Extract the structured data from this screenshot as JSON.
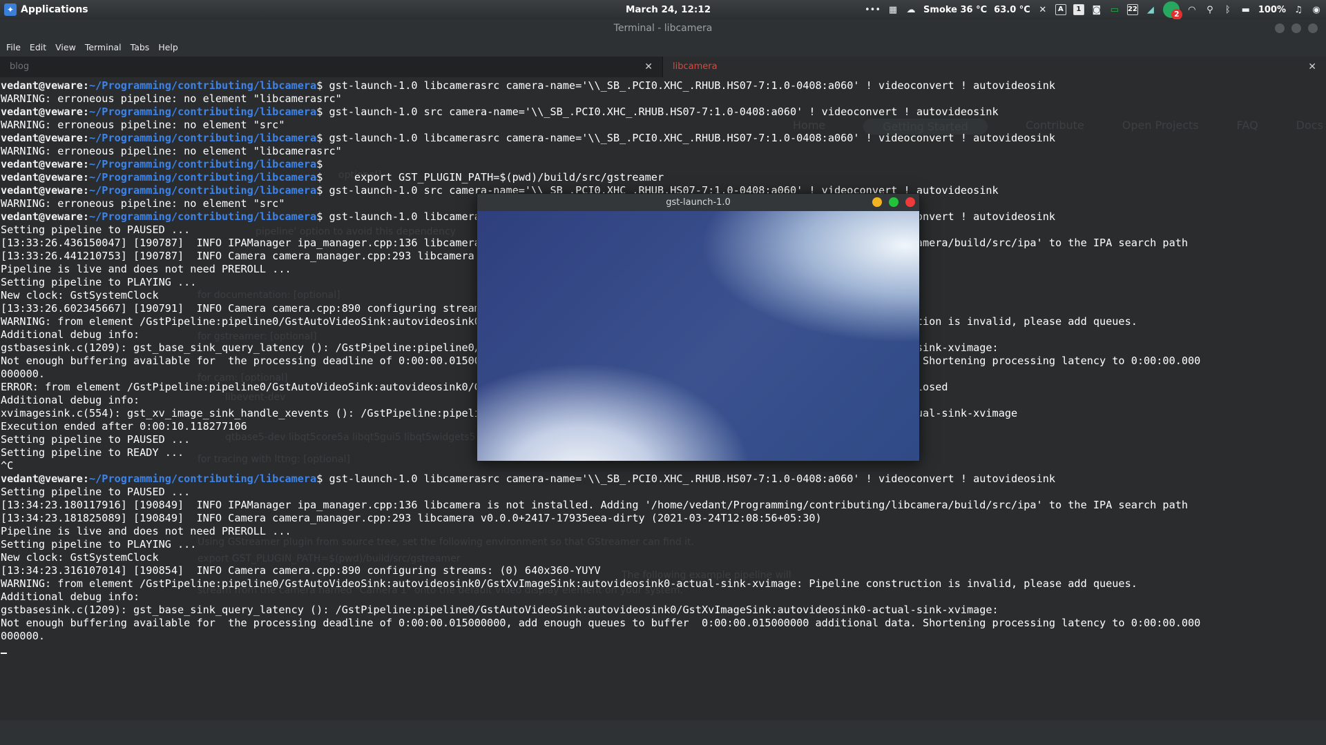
{
  "panel": {
    "apps_label": "Applications",
    "clock": "March 24, 12:12",
    "weather": "Smoke 36 °C",
    "temperature": "63.0 °C",
    "battery": "100%",
    "notify_count": "2",
    "workspace": "1",
    "keyboard": "A",
    "chat_num": "22"
  },
  "window": {
    "title": "Terminal - libcamera"
  },
  "menu": [
    "File",
    "Edit",
    "View",
    "Terminal",
    "Tabs",
    "Help"
  ],
  "tabs": [
    {
      "label": "blog"
    },
    {
      "label": "libcamera"
    }
  ],
  "prompt": {
    "user": "vedant@veware",
    "path": "~/Programming/contributing/libcamera"
  },
  "lines": [
    {
      "p": true,
      "t": "gst-launch-1.0 libcamerasrc camera-name='\\\\_SB_.PCI0.XHC_.RHUB.HS07-7:1.0-0408:a060' ! videoconvert ! autovideosink"
    },
    {
      "t": "WARNING: erroneous pipeline: no element \"libcamerasrc\""
    },
    {
      "p": true,
      "t": "gst-launch-1.0 src camera-name='\\\\_SB_.PCI0.XHC_.RHUB.HS07-7:1.0-0408:a060' ! videoconvert ! autovideosink"
    },
    {
      "t": "WARNING: erroneous pipeline: no element \"src\""
    },
    {
      "p": true,
      "t": "gst-launch-1.0 libcamerasrc camera-name='\\\\_SB_.PCI0.XHC_.RHUB.HS07-7:1.0-0408:a060' ! videoconvert ! autovideosink"
    },
    {
      "t": "WARNING: erroneous pipeline: no element \"libcamerasrc\""
    },
    {
      "p": true,
      "t": ""
    },
    {
      "p": true,
      "t": "    export GST_PLUGIN_PATH=$(pwd)/build/src/gstreamer"
    },
    {
      "p": true,
      "t": "gst-launch-1.0 src camera-name='\\\\_SB_.PCI0.XHC_.RHUB.HS07-7:1.0-0408:a060' ! videoconvert ! autovideosink"
    },
    {
      "t": "WARNING: erroneous pipeline: no element \"src\""
    },
    {
      "p": true,
      "t": "gst-launch-1.0 libcamerasrc camera-name='\\\\_SB_.PCI0.XHC_.RHUB.HS07-7:1.0-0408:a060' ! videoconvert ! autovideosink"
    },
    {
      "t": "Setting pipeline to PAUSED ..."
    },
    {
      "t": "[13:33:26.436150047] [190787]  INFO IPAManager ipa_manager.cpp:136 libcamera is not installed. Adding '/home/vedant/Programming/contributing/libcamera/build/src/ipa' to the IPA search path"
    },
    {
      "t": "[13:33:26.441210753] [190787]  INFO Camera camera_manager.cpp:293 libcamera v0.0.0+2417-17935eea-dirty (2021-03-24T12:08:56+05:30)"
    },
    {
      "t": "Pipeline is live and does not need PREROLL ..."
    },
    {
      "t": "Setting pipeline to PLAYING ..."
    },
    {
      "t": "New clock: GstSystemClock"
    },
    {
      "t": "[13:33:26.602345667] [190791]  INFO Camera camera.cpp:890 configuring streams: (0) 640x360-YUYV"
    },
    {
      "t": "WARNING: from element /GstPipeline:pipeline0/GstAutoVideoSink:autovideosink0/GstXvImageSink:autovideosink0-actual-sink-xvimage: Pipeline construction is invalid, please add queues."
    },
    {
      "t": "Additional debug info:"
    },
    {
      "t": "gstbasesink.c(1209): gst_base_sink_query_latency (): /GstPipeline:pipeline0/GstAutoVideoSink:autovideosink0/GstXvImageSink:autovideosink0-actual-sink-xvimage:"
    },
    {
      "t": "Not enough buffering available for  the processing deadline of 0:00:00.015000000, add enough queues to buffer  0:00:00.015000000 additional data. Shortening processing latency to 0:00:00.000"
    },
    {
      "t": "000000."
    },
    {
      "t": "ERROR: from element /GstPipeline:pipeline0/GstAutoVideoSink:autovideosink0/GstXvImageSink:autovideosink0-actual-sink-xvimage: Output window was closed"
    },
    {
      "t": "Additional debug info:"
    },
    {
      "t": "xvimagesink.c(554): gst_xv_image_sink_handle_xevents (): /GstPipeline:pipeline0/GstAutoVideoSink:autovideosink0/GstXvImageSink:autovideosink0-actual-sink-xvimage"
    },
    {
      "t": "Execution ended after 0:00:10.118277106"
    },
    {
      "t": "Setting pipeline to PAUSED ..."
    },
    {
      "t": "Setting pipeline to READY ..."
    },
    {
      "t": "^C"
    },
    {
      "p": true,
      "t": "gst-launch-1.0 libcamerasrc camera-name='\\\\_SB_.PCI0.XHC_.RHUB.HS07-7:1.0-0408:a060' ! videoconvert ! autovideosink"
    },
    {
      "t": "Setting pipeline to PAUSED ..."
    },
    {
      "t": "[13:34:23.180117916] [190849]  INFO IPAManager ipa_manager.cpp:136 libcamera is not installed. Adding '/home/vedant/Programming/contributing/libcamera/build/src/ipa' to the IPA search path"
    },
    {
      "t": "[13:34:23.181825089] [190849]  INFO Camera camera_manager.cpp:293 libcamera v0.0.0+2417-17935eea-dirty (2021-03-24T12:08:56+05:30)"
    },
    {
      "t": "Pipeline is live and does not need PREROLL ..."
    },
    {
      "t": "Setting pipeline to PLAYING ..."
    },
    {
      "t": "New clock: GstSystemClock"
    },
    {
      "t": "[13:34:23.316107014] [190854]  INFO Camera camera.cpp:890 configuring streams: (0) 640x360-YUYV"
    },
    {
      "t": "WARNING: from element /GstPipeline:pipeline0/GstAutoVideoSink:autovideosink0/GstXvImageSink:autovideosink0-actual-sink-xvimage: Pipeline construction is invalid, please add queues."
    },
    {
      "t": "Additional debug info:"
    },
    {
      "t": "gstbasesink.c(1209): gst_base_sink_query_latency (): /GstPipeline:pipeline0/GstAutoVideoSink:autovideosink0/GstXvImageSink:autovideosink0-actual-sink-xvimage:"
    },
    {
      "t": "Not enough buffering available for  the processing deadline of 0:00:00.015000000, add enough queues to buffer  0:00:00.015000000 additional data. Shortening processing latency to 0:00:00.000"
    },
    {
      "t": "000000."
    }
  ],
  "ghost": {
    "nav": [
      "Home",
      "Getting Started",
      "Contribute",
      "Open Projects",
      "FAQ",
      "Docs"
    ],
    "texts": [
      "optional]",
      "pipeline' option to avoid this dependency",
      "for documentation: [optional]",
      "for gstreamer: [optional]",
      "for cam: [optional]",
      "libevent-dev",
      "qtbase5-dev libqt5core5a libqt5gui5 libqt5widgets5",
      "for tracing with lttng: [optional]",
      "Using GStreamer plugin from source tree, set the following environment so that GStreamer can find it.",
      "export GST_PLUGIN_PATH=$(pwd)/build/src/gstreamer",
      "The following example pipeline will",
      "stream from the camera named \"Camera 1\" onto the default video display element on your system."
    ]
  },
  "video_window": {
    "title": "gst-launch-1.0"
  }
}
